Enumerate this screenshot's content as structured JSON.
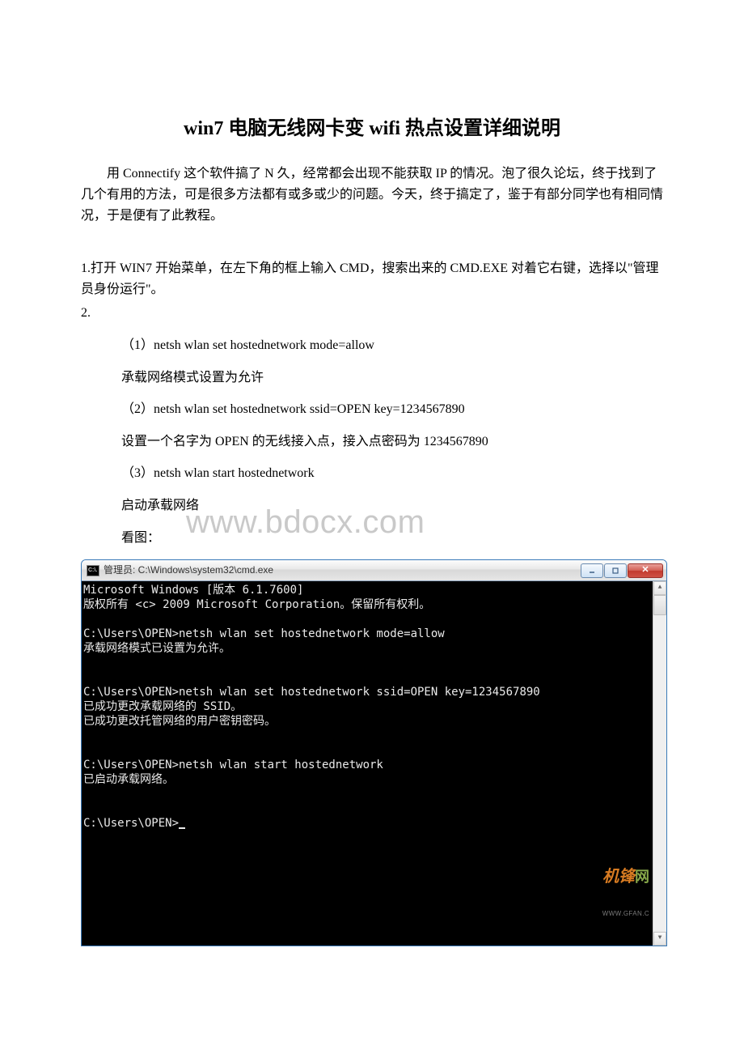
{
  "title": "win7 电脑无线网卡变 wifi 热点设置详细说明",
  "intro": "用 Connectify 这个软件搞了 N 久，经常都会出现不能获取 IP 的情况。泡了很久论坛，终于找到了几个有用的方法，可是很多方法都有或多或少的问题。今天，终于搞定了，鉴于有部分同学也有相同情况，于是便有了此教程。",
  "step1": "1.打开 WIN7 开始菜单，在左下角的框上输入 CMD，搜索出来的 CMD.EXE 对着它右键，选择以\"管理员身份运行\"。",
  "step2": "2.",
  "cmds": {
    "c1": "（1）netsh wlan set hostednetwork mode=allow",
    "d1": "承载网络模式设置为允许",
    "c2": "（2）netsh wlan set hostednetwork ssid=OPEN key=1234567890",
    "d2": "设置一个名字为 OPEN 的无线接入点，接入点密码为 1234567890",
    "c3": "（3）netsh wlan start hostednetwork",
    "d3": "启动承载网络",
    "see": "看图："
  },
  "watermark": "www.bdocx.com",
  "cmdwin": {
    "title": "管理员: C:\\Windows\\system32\\cmd.exe",
    "icon": "C:\\.",
    "lines": {
      "l1": "Microsoft Windows [版本 6.1.7600]",
      "l2": "版权所有 <c> 2009 Microsoft Corporation。保留所有权利。",
      "l3": "C:\\Users\\OPEN>netsh wlan set hostednetwork mode=allow",
      "l4": "承载网络模式已设置为允许。",
      "l5": "C:\\Users\\OPEN>netsh wlan set hostednetwork ssid=OPEN key=1234567890",
      "l6": "已成功更改承载网络的 SSID。",
      "l7": "已成功更改托管网络的用户密钥密码。",
      "l8": "C:\\Users\\OPEN>netsh wlan start hostednetwork",
      "l9": "已启动承载网络。",
      "l10": "C:\\Users\\OPEN>"
    },
    "logo": {
      "main": "机锋",
      "wang": "网",
      "url": "WWW.GFAN.C"
    }
  }
}
